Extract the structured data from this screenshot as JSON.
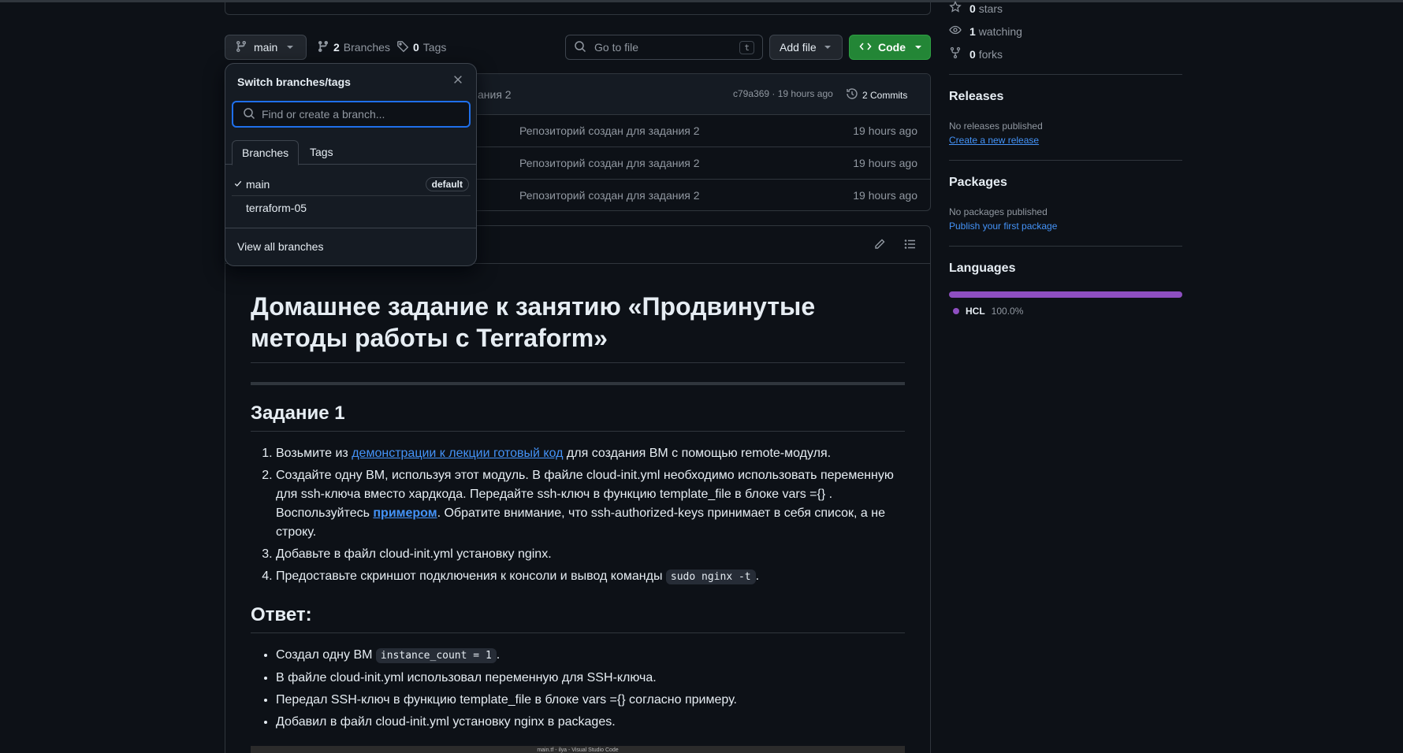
{
  "branch_bar": {
    "branch_label": "main",
    "branches_count": "2",
    "branches_label": "Branches",
    "tags_count": "0",
    "tags_label": "Tags",
    "go_to_file_placeholder": "Go to file",
    "go_to_file_shortcut": "t",
    "add_file_label": "Add file",
    "code_label": "Code"
  },
  "latest_commit": {
    "message_partial": "ания 2",
    "hash": "c79a369",
    "separator": "·",
    "time": "19 hours ago",
    "commits_label": "2 Commits"
  },
  "file_rows": [
    {
      "message": "Репозиторий создан для задания 2",
      "time": "19 hours ago"
    },
    {
      "message": "Репозиторий создан для задания 2",
      "time": "19 hours ago"
    },
    {
      "message": "Репозиторий создан для задания 2",
      "time": "19 hours ago"
    }
  ],
  "branch_dropdown": {
    "title": "Switch branches/tags",
    "search_placeholder": "Find or create a branch...",
    "tabs": [
      "Branches",
      "Tags"
    ],
    "branches": [
      {
        "name": "main",
        "selected": true,
        "badge": "default"
      },
      {
        "name": "terraform-05",
        "selected": false,
        "badge": ""
      }
    ],
    "footer": "View all branches"
  },
  "readme": {
    "title": "Домашнее задание к занятию «Продвинутые методы работы с Terraform»",
    "task_heading": "Задание 1",
    "task_items": {
      "i1_prefix": "Возьмите из ",
      "i1_link": "демонстрации к лекции готовый код",
      "i1_suffix": " для создания ВМ с помощью remote-модуля.",
      "i2_prefix": "Создайте одну ВМ, используя этот модуль. В файле cloud-init.yml необходимо использовать переменную для ssh-ключа вместо хардкода. Передайте ssh-ключ в функцию template_file в блоке vars ={} . Воспользуйтесь ",
      "i2_link": "примером",
      "i2_suffix": ". Обратите внимание, что ssh-authorized-keys принимает в себя список, а не строку.",
      "i3": "Добавьте в файл cloud-init.yml установку nginx.",
      "i4_prefix": "Предоставьте скриншот подключения к консоли и вывод команды ",
      "i4_code": "sudo nginx -t",
      "i4_suffix": "."
    },
    "answer_heading": "Ответ:",
    "answer_items": {
      "a1_prefix": "Создал одну ВМ ",
      "a1_code": "instance_count = 1",
      "a1_suffix": ".",
      "a2": "В файле cloud-init.yml использовал переменную для SSH-ключа.",
      "a3": "Передал SSH-ключ в функцию template_file в блоке vars ={} согласно примеру.",
      "a4": "Добавил в файл cloud-init.yml установку nginx в packages."
    },
    "screenshot_caption": "main.tf - ilya - Visual Studio Code"
  },
  "sidebar": {
    "stars_count": "0",
    "stars_label": "stars",
    "watching_count": "1",
    "watching_label": "watching",
    "forks_count": "0",
    "forks_label": "forks",
    "releases_heading": "Releases",
    "releases_note": "No releases published",
    "releases_link": "Create a new release",
    "packages_heading": "Packages",
    "packages_note": "No packages published",
    "packages_link": "Publish your first package",
    "languages_heading": "Languages",
    "languages": [
      {
        "name": "HCL",
        "percent": "100.0%",
        "color": "#8e4fc1"
      }
    ]
  },
  "colors": {
    "background": "#0d1117",
    "accent_link": "#4493f8",
    "code_button": "#238636",
    "focus_border": "#1f6feb"
  }
}
